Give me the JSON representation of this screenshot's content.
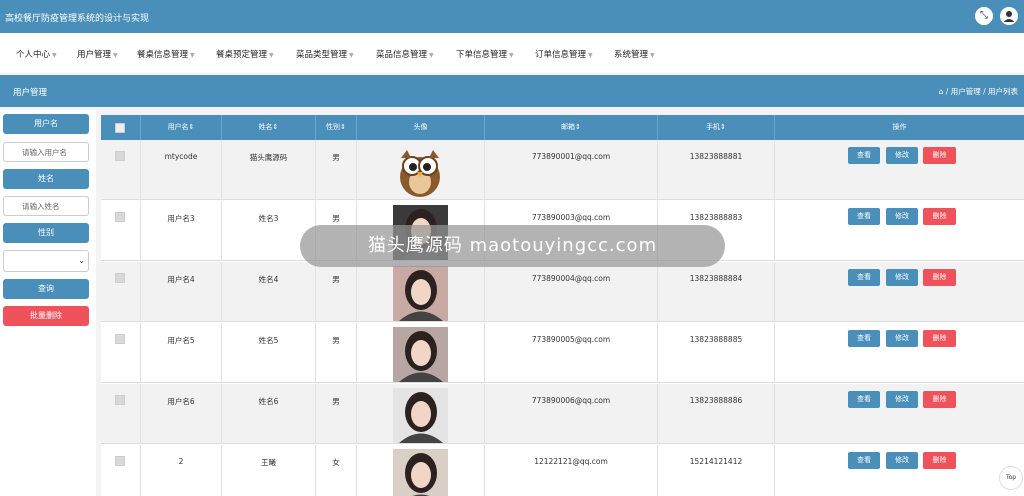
{
  "app": {
    "title": "高校餐厅防疫管理系统的设计与实现",
    "icons": {
      "fullscreen": "fullscreen-icon",
      "user": "user-icon"
    },
    "colors": {
      "primary": "#4a8fb9",
      "danger": "#f0525c",
      "background": "#f3f3f3"
    }
  },
  "nav": {
    "items": [
      {
        "label": "个人中心"
      },
      {
        "label": "用户管理"
      },
      {
        "label": "餐桌信息管理"
      },
      {
        "label": "餐桌预定管理"
      },
      {
        "label": "菜品类型管理"
      },
      {
        "label": "菜品信息管理"
      },
      {
        "label": "下单信息管理"
      },
      {
        "label": "订单信息管理"
      },
      {
        "label": "系统管理"
      }
    ]
  },
  "page": {
    "title": "用户管理",
    "breadcrumb": "/ 用户管理 / 用户列表"
  },
  "filters": {
    "username_label": "用户名",
    "username_placeholder": "请输入用户名",
    "name_label": "姓名",
    "name_placeholder": "请输入姓名",
    "gender_label": "性别",
    "gender_value": "",
    "query_button": "查询",
    "batch_delete_button": "批量删除"
  },
  "table": {
    "columns": [
      "用户名⇕",
      "姓名⇕",
      "性别⇕",
      "头像",
      "邮箱⇕",
      "手机⇕",
      "操作"
    ],
    "actions": {
      "view": "查看",
      "edit": "修改",
      "delete": "删除"
    },
    "rows": [
      {
        "username": "mtycode",
        "name": "猫头鹰源码",
        "gender": "男",
        "avatar": "owl-cartoon",
        "email": "773890001@qq.com",
        "phone": "13823888881"
      },
      {
        "username": "用户名3",
        "name": "姓名3",
        "gender": "男",
        "avatar": "person-photo",
        "email": "773890003@qq.com",
        "phone": "13823888883"
      },
      {
        "username": "用户名4",
        "name": "姓名4",
        "gender": "男",
        "avatar": "person-photo",
        "email": "773890004@qq.com",
        "phone": "13823888884"
      },
      {
        "username": "用户名5",
        "name": "姓名5",
        "gender": "男",
        "avatar": "person-photo",
        "email": "773890005@qq.com",
        "phone": "13823888885"
      },
      {
        "username": "用户名6",
        "name": "姓名6",
        "gender": "男",
        "avatar": "person-photo",
        "email": "773890006@qq.com",
        "phone": "13823888886"
      },
      {
        "username": "2",
        "name": "王曦",
        "gender": "女",
        "avatar": "person-photo",
        "email": "12122121@qq.com",
        "phone": "15214121412"
      }
    ]
  },
  "overlay": {
    "watermark": "猫头鹰源码 maotouyingcc.com"
  },
  "scroll_top": "Top"
}
